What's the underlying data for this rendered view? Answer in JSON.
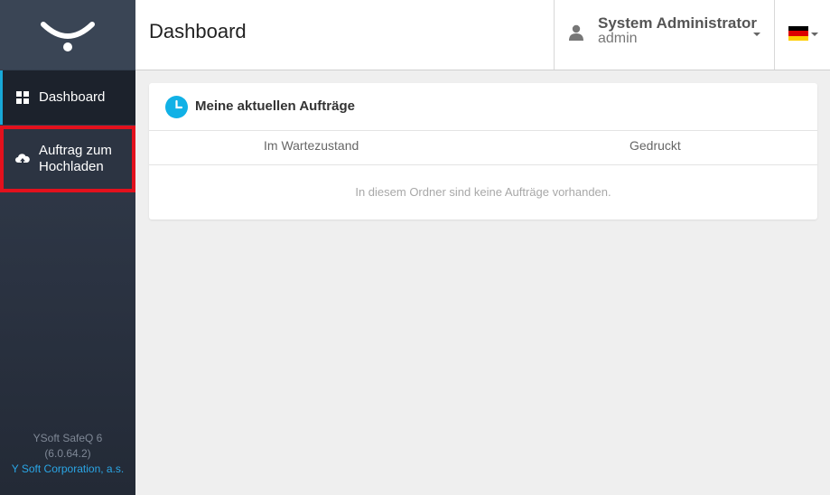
{
  "header": {
    "title": "Dashboard",
    "user": {
      "name": "System Administrator",
      "login": "admin"
    },
    "language_flag": "de"
  },
  "sidebar": {
    "items": [
      {
        "label": "Dashboard",
        "icon": "grid-icon",
        "active": true
      },
      {
        "label": "Auftrag zum\nHochladen",
        "label_line1": "Auftrag zum",
        "label_line2": "Hochladen",
        "icon": "cloud-upload-icon",
        "highlighted": true
      }
    ],
    "footer": {
      "product": "YSoft SafeQ 6",
      "version": "(6.0.64.2)",
      "company": "Y Soft Corporation, a.s."
    }
  },
  "panel": {
    "title": "Meine aktuellen Aufträge",
    "columns": [
      "Im Wartezustand",
      "Gedruckt"
    ],
    "empty_message": "In diesem Ordner sind keine Aufträge vorhanden."
  },
  "colors": {
    "accent": "#18a8d8",
    "highlight": "#e3111d",
    "sidebar_bg": "#2b3342",
    "link": "#2aa6e6"
  }
}
